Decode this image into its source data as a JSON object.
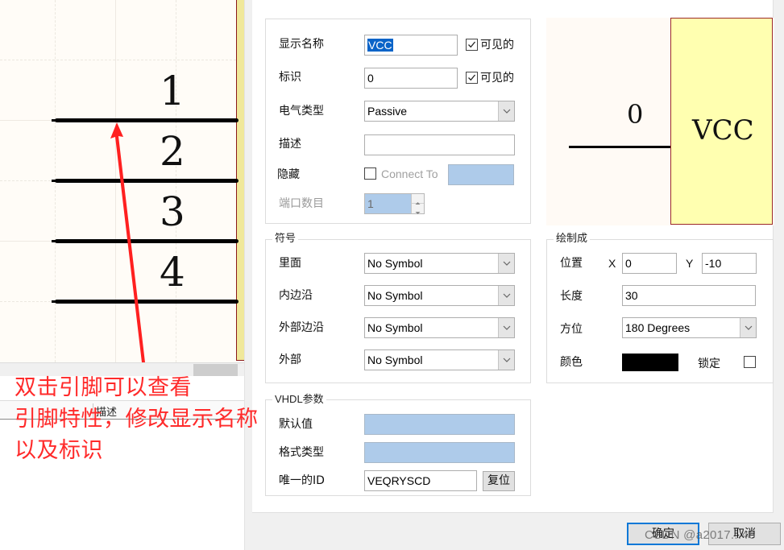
{
  "schematic": {
    "pins": [
      {
        "number": "1"
      },
      {
        "number": "2"
      },
      {
        "number": "3"
      },
      {
        "number": "4"
      }
    ],
    "list_header_column": "描述"
  },
  "annotation": {
    "lines": [
      "双击引脚可以查看",
      "引脚特性，修改显示名称",
      "以及标识"
    ],
    "color": "#ff2a2a"
  },
  "dialog": {
    "general": {
      "display_name_label": "显示名称",
      "display_name_value": "VCC",
      "display_name_visible_label": "可见的",
      "display_name_visible": true,
      "designator_label": "标识",
      "designator_value": "0",
      "designator_visible_label": "可见的",
      "designator_visible": true,
      "electrical_type_label": "电气类型",
      "electrical_type_value": "Passive",
      "description_label": "描述",
      "description_value": "",
      "hidden_label": "隐藏",
      "hidden_checked": false,
      "connect_to_label": "Connect To",
      "connect_to_value": "",
      "port_count_label": "端口数目",
      "port_count_value": "1"
    },
    "symbols": {
      "legend": "符号",
      "inside_label": "里面",
      "inside_value": "No Symbol",
      "inside_edge_label": "内边沿",
      "inside_edge_value": "No Symbol",
      "outside_edge_label": "外部边沿",
      "outside_edge_value": "No Symbol",
      "outside_label": "外部",
      "outside_value": "No Symbol"
    },
    "graphical": {
      "legend": "绘制成",
      "location_label": "位置",
      "x_label": "X",
      "x_value": "0",
      "y_label": "Y",
      "y_value": "-10",
      "length_label": "长度",
      "length_value": "30",
      "orientation_label": "方位",
      "orientation_value": "180 Degrees",
      "color_label": "颜色",
      "color_value": "#000000",
      "locked_label": "锁定",
      "locked": false
    },
    "vhdl": {
      "legend": "VHDL参数",
      "default_value_label": "默认值",
      "default_value": "",
      "format_type_label": "格式类型",
      "format_type_value": "",
      "unique_id_label": "唯一的ID",
      "unique_id_value": "VEQRYSCD",
      "reset_label": "复位"
    },
    "preview": {
      "pin_number": "0",
      "pin_name": "VCC"
    },
    "buttons": {
      "ok_label": "确定",
      "cancel_label": "取消"
    }
  },
  "watermark": "CSDN @a2017...46"
}
